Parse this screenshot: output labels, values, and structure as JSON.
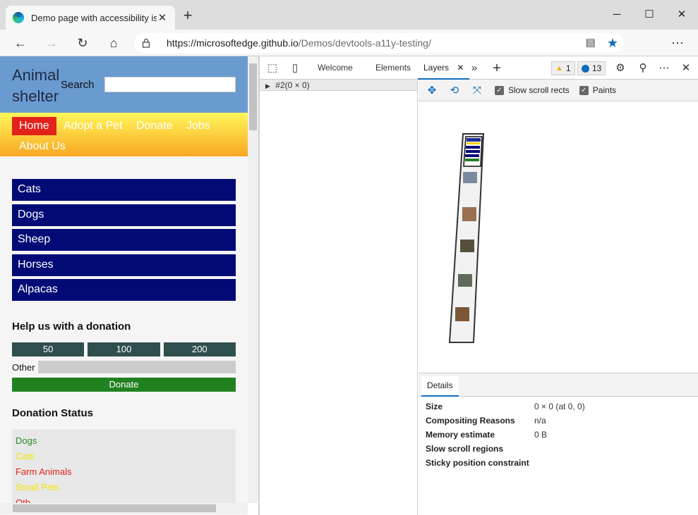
{
  "browser": {
    "tab_title": "Demo page with accessibility issu",
    "url_host": "https://microsoftedge.github.io",
    "url_path": "/Demos/devtools-a11y-testing/"
  },
  "site": {
    "logo": "Animal shelter",
    "search_label": "Search",
    "nav": [
      "Home",
      "Adopt a Pet",
      "Donate",
      "Jobs",
      "About Us"
    ],
    "menu": [
      "Cats",
      "Dogs",
      "Sheep",
      "Horses",
      "Alpacas"
    ],
    "donation_heading": "Help us with a donation",
    "amounts": [
      "50",
      "100",
      "200"
    ],
    "other_label": "Other",
    "donate_label": "Donate",
    "status_heading": "Donation Status",
    "status_items": [
      {
        "label": "Dogs",
        "color": "#2e8b2e"
      },
      {
        "label": "Cats",
        "color": "#f2e600"
      },
      {
        "label": "Farm Animals",
        "color": "#e2221b"
      },
      {
        "label": "Small Pets",
        "color": "#f2e600"
      },
      {
        "label": "Oth",
        "color": "#e2221b"
      }
    ]
  },
  "devtools": {
    "tabs": [
      "Welcome",
      "Elements",
      "Layers"
    ],
    "warnings": "1",
    "messages": "13",
    "tree_row": "#2(0 × 0)",
    "layer_tools": {
      "slow_scroll_label": "Slow scroll rects",
      "paints_label": "Paints"
    },
    "details_tab": "Details",
    "details": [
      {
        "key": "Size",
        "value": "0 × 0 (at 0, 0)"
      },
      {
        "key": "Compositing Reasons",
        "value": "n/a"
      },
      {
        "key": "Memory estimate",
        "value": "0 B"
      },
      {
        "key": "Slow scroll regions",
        "value": ""
      },
      {
        "key": "Sticky position constraint",
        "value": ""
      }
    ]
  }
}
